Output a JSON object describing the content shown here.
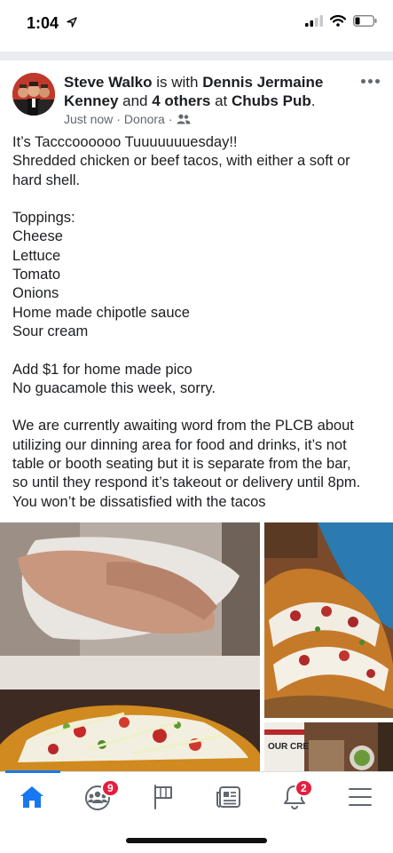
{
  "status": {
    "time": "1:04",
    "location_icon": "location-arrow-icon",
    "signal_icon": "cellular-signal-icon",
    "wifi_icon": "wifi-icon",
    "battery_icon": "battery-low-icon"
  },
  "post": {
    "author": "Steve Walko",
    "with_text": " is with ",
    "tagged_person": "Dennis Jermaine Kenney",
    "and_text": " and ",
    "others": "4 others",
    "at_text": " at ",
    "place": "Chubs Pub",
    "period": ".",
    "time": "Just now",
    "location": "Donora",
    "separator": "·",
    "audience_icon": "friends-icon",
    "more_icon": "more-options-icon",
    "lines": [
      "It’s Tacccoooooo Tuuuuuuuesday!!",
      "Shredded chicken or beef tacos, with either a soft or",
      "hard shell.",
      "",
      "Toppings:",
      "Cheese",
      "Lettuce",
      "Tomato",
      "Onions",
      "Home made chipotle sauce",
      "Sour cream",
      "",
      "Add $1 for home made pico",
      "No guacamole this week, sorry.",
      "",
      "We are currently awaiting word from the PLCB about",
      "utilizing our dinning area for food and drinks, it’s not",
      "table or booth seating but it is separate from the bar,",
      "so until they respond it’s takeout or delivery until 8pm.",
      "You won’t be dissatisfied with the tacos"
    ],
    "sign_text": "OUR CRE"
  },
  "tabs": {
    "home_icon": "home-icon",
    "groups_icon": "groups-icon",
    "groups_badge": "9",
    "pages_icon": "flag-icon",
    "news_icon": "news-icon",
    "notifications_icon": "bell-icon",
    "notifications_badge": "2",
    "menu_icon": "menu-icon"
  },
  "colors": {
    "accent": "#1877f2",
    "badge": "#e41e3f",
    "text": "#1c1e21",
    "secondary": "#606770"
  }
}
